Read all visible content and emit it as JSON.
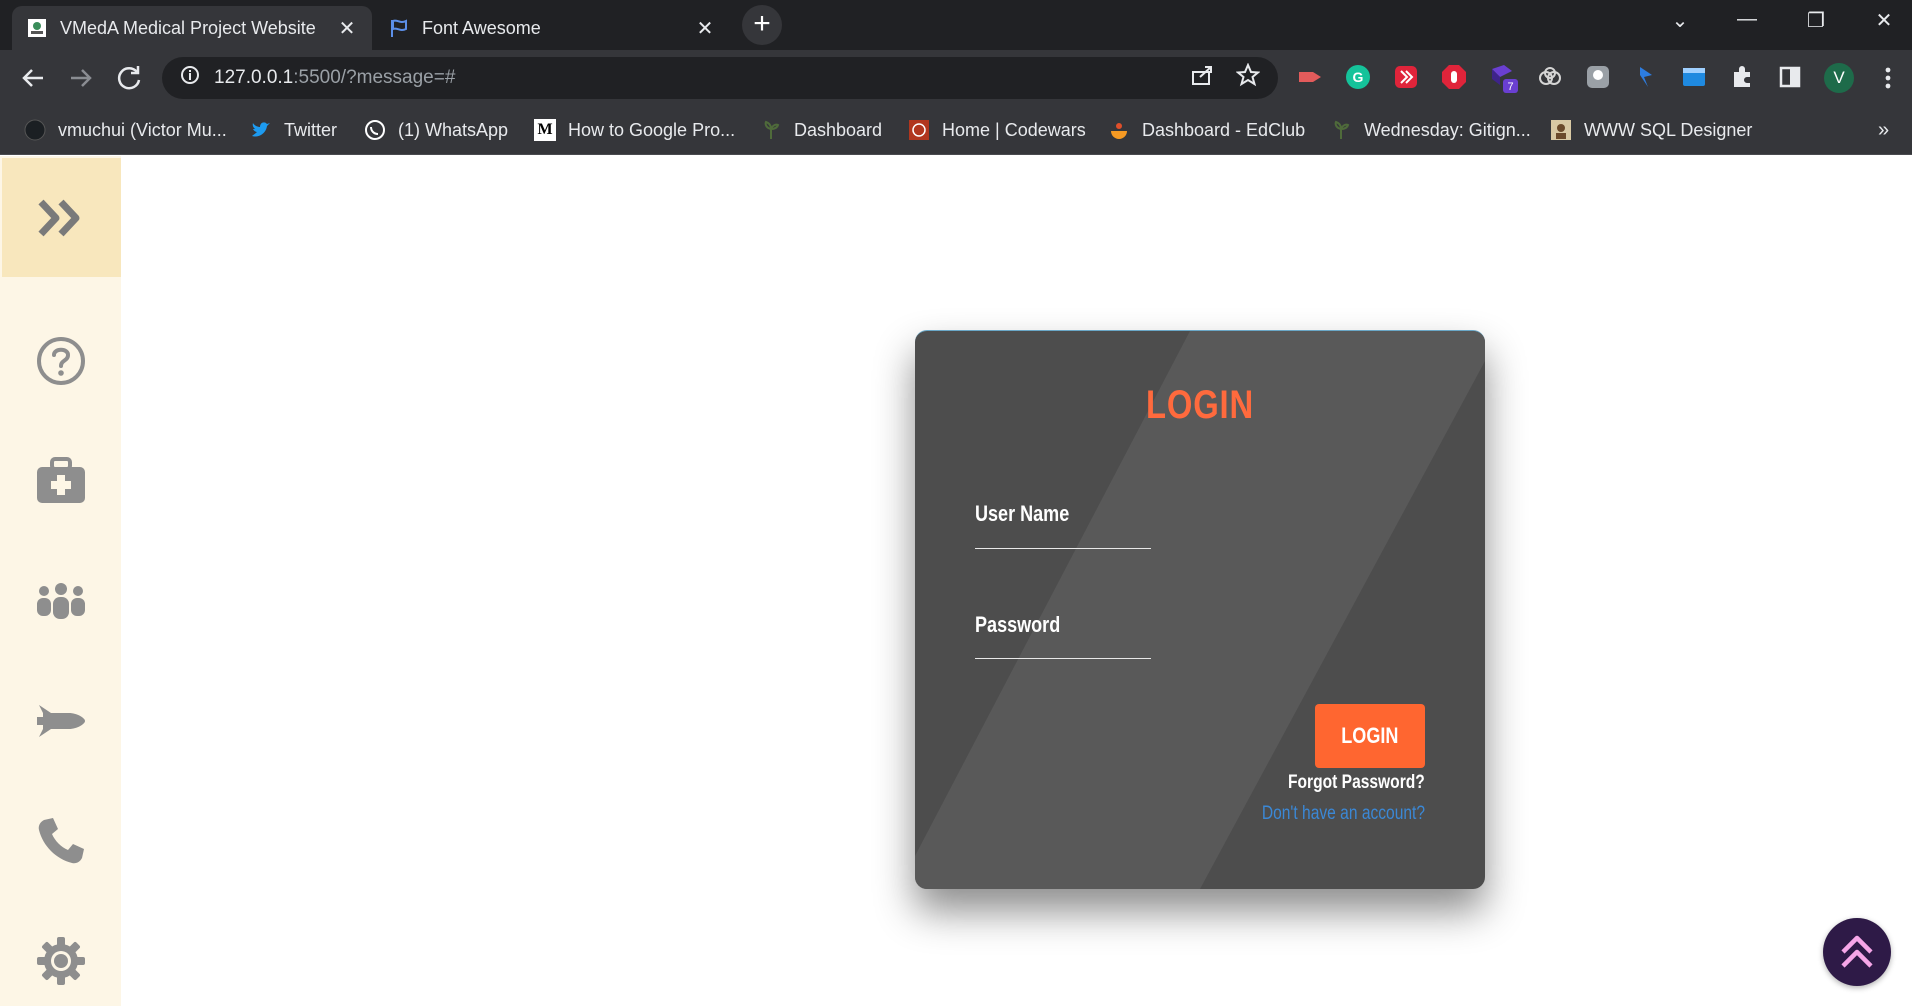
{
  "tabs": [
    {
      "title": "VMedA Medical Project Website",
      "active": true
    },
    {
      "title": "Font Awesome",
      "active": false
    }
  ],
  "address_bar": {
    "host": "127.0.0.1",
    "path": ":5500/?message=#"
  },
  "profile_initial": "V",
  "extension_badge": "7",
  "bookmarks": [
    {
      "label": "vmuchui (Victor Mu...",
      "icon": "github-icon"
    },
    {
      "label": "Twitter",
      "icon": "twitter-icon"
    },
    {
      "label": "(1) WhatsApp",
      "icon": "whatsapp-icon"
    },
    {
      "label": "How to Google Pro...",
      "icon": "medium-icon"
    },
    {
      "label": "Dashboard",
      "icon": "leaf-icon"
    },
    {
      "label": "Home | Codewars",
      "icon": "codewars-icon"
    },
    {
      "label": "Dashboard - EdClub",
      "icon": "edclub-icon"
    },
    {
      "label": "Wednesday: Gitign...",
      "icon": "leaf-icon"
    },
    {
      "label": "WWW SQL Designer",
      "icon": "sql-designer-icon"
    }
  ],
  "sidebar": {
    "items": [
      {
        "icon": "question-circle-icon"
      },
      {
        "icon": "medkit-icon"
      },
      {
        "icon": "people-group-icon"
      },
      {
        "icon": "shuttle-icon"
      },
      {
        "icon": "phone-icon"
      },
      {
        "icon": "gear-icon"
      }
    ]
  },
  "login": {
    "title": "LOGIN",
    "username_label": "User Name",
    "password_label": "Password",
    "button_label": "LOGIN",
    "forgot_password": "Forgot Password?",
    "signup_link": "Don't have an account?"
  },
  "colors": {
    "accent": "#ff6630",
    "card": "#4d4d4d",
    "sidebar": "#fdf6e6",
    "link": "#3b88d6"
  }
}
